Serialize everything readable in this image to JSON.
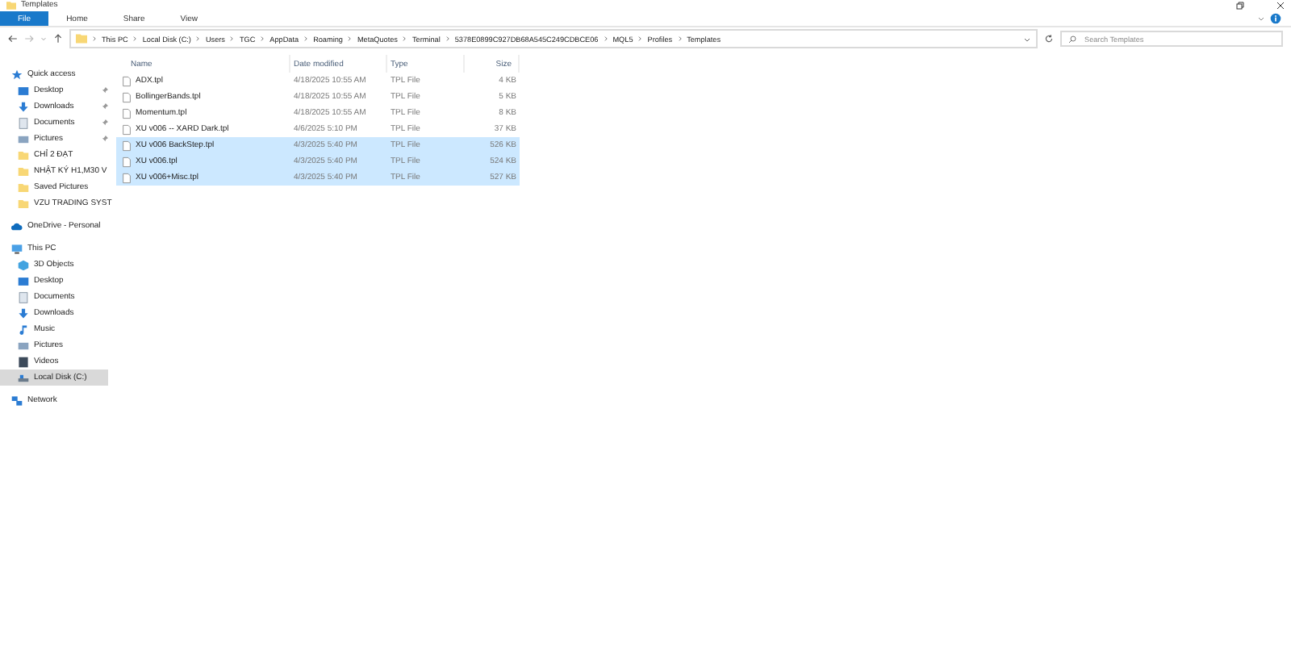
{
  "window": {
    "title": "Templates"
  },
  "ribbon_tabs": [
    {
      "label": "File",
      "selected": true
    },
    {
      "label": "Home",
      "selected": false
    },
    {
      "label": "Share",
      "selected": false
    },
    {
      "label": "View",
      "selected": false
    }
  ],
  "address_bar": {
    "segments": [
      "This PC",
      "Local Disk (C:)",
      "Users",
      "TGC",
      "AppData",
      "Roaming",
      "MetaQuotes",
      "Terminal",
      "5378E0899C927DB68A545C249CDBCE06",
      "MQL5",
      "Profiles",
      "Templates"
    ]
  },
  "search": {
    "placeholder": "Search Templates"
  },
  "sidebar": {
    "items": [
      {
        "label": "Quick access",
        "kind": "star",
        "selected": false,
        "children": [
          {
            "label": "Desktop",
            "kind": "desktop",
            "pinned": true,
            "selected": false
          },
          {
            "label": "Downloads",
            "kind": "download",
            "pinned": true,
            "selected": false
          },
          {
            "label": "Documents",
            "kind": "documents",
            "pinned": true,
            "selected": false
          },
          {
            "label": "Pictures",
            "kind": "pictures",
            "pinned": true,
            "selected": false
          },
          {
            "label": "CHỈ 2 ĐẠT",
            "kind": "folder",
            "pinned": false,
            "selected": false
          },
          {
            "label": "NHẬT KÝ H1,M30 V",
            "kind": "folder",
            "pinned": false,
            "selected": false
          },
          {
            "label": "Saved Pictures",
            "kind": "folder",
            "pinned": false,
            "selected": false
          },
          {
            "label": "VZU TRADING SYST",
            "kind": "folder",
            "pinned": false,
            "selected": false
          }
        ]
      },
      {
        "label": "OneDrive - Personal",
        "kind": "cloud",
        "selected": false
      },
      {
        "label": "This PC",
        "kind": "pc",
        "selected": false,
        "children": [
          {
            "label": "3D Objects",
            "kind": "cube",
            "pinned": false,
            "selected": false
          },
          {
            "label": "Desktop",
            "kind": "desktop",
            "pinned": false,
            "selected": false
          },
          {
            "label": "Documents",
            "kind": "documents",
            "pinned": false,
            "selected": false
          },
          {
            "label": "Downloads",
            "kind": "download",
            "pinned": false,
            "selected": false
          },
          {
            "label": "Music",
            "kind": "music",
            "pinned": false,
            "selected": false
          },
          {
            "label": "Pictures",
            "kind": "pictures",
            "pinned": false,
            "selected": false
          },
          {
            "label": "Videos",
            "kind": "video",
            "pinned": false,
            "selected": false
          },
          {
            "label": "Local Disk (C:)",
            "kind": "drive",
            "pinned": false,
            "selected": true
          }
        ]
      },
      {
        "label": "Network",
        "kind": "network",
        "selected": false
      }
    ]
  },
  "table": {
    "columns": [
      "Name",
      "Date modified",
      "Type",
      "Size"
    ],
    "rows": [
      {
        "name": "ADX.tpl",
        "date": "4/18/2025 10:55 AM",
        "type": "TPL File",
        "size": "4 KB",
        "selected": false
      },
      {
        "name": "BollingerBands.tpl",
        "date": "4/18/2025 10:55 AM",
        "type": "TPL File",
        "size": "5 KB",
        "selected": false
      },
      {
        "name": "Momentum.tpl",
        "date": "4/18/2025 10:55 AM",
        "type": "TPL File",
        "size": "8 KB",
        "selected": false
      },
      {
        "name": "XU v006 -- XARD Dark.tpl",
        "date": "4/6/2025 5:10 PM",
        "type": "TPL File",
        "size": "37 KB",
        "selected": false
      },
      {
        "name": "XU v006 BackStep.tpl",
        "date": "4/3/2025 5:40 PM",
        "type": "TPL File",
        "size": "526 KB",
        "selected": true
      },
      {
        "name": "XU v006.tpl",
        "date": "4/3/2025 5:40 PM",
        "type": "TPL File",
        "size": "524 KB",
        "selected": true
      },
      {
        "name": "XU v006+Misc.tpl",
        "date": "4/3/2025 5:40 PM",
        "type": "TPL File",
        "size": "527 KB",
        "selected": true
      }
    ]
  }
}
